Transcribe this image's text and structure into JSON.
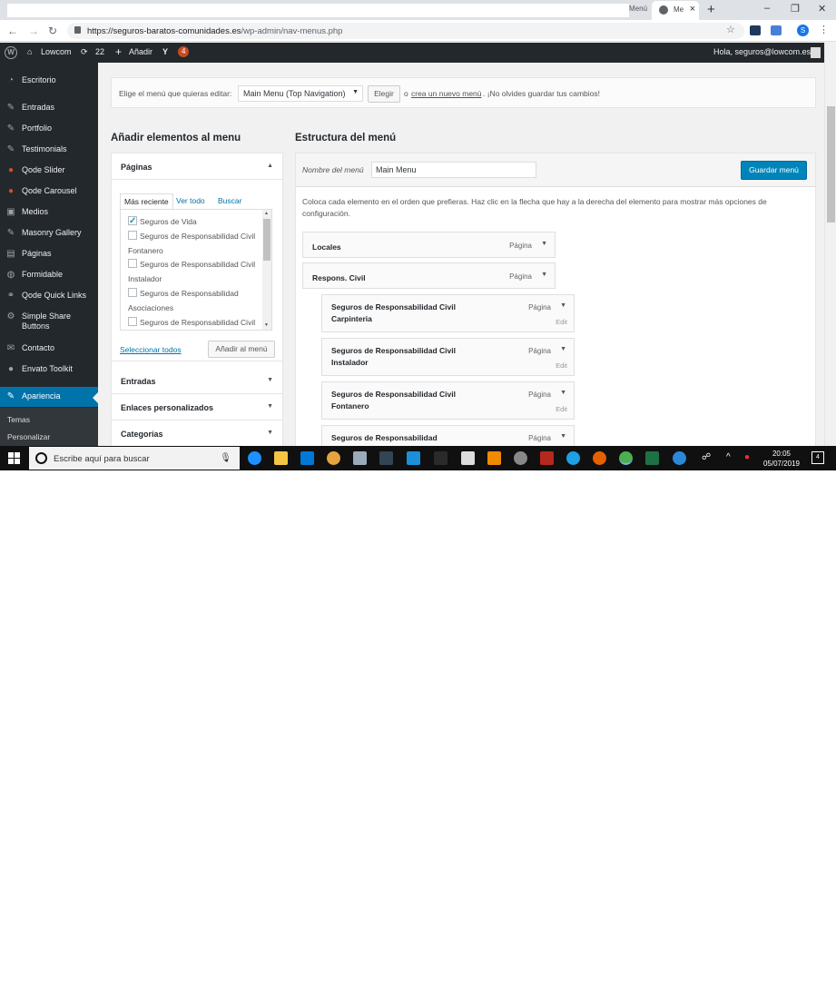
{
  "browser": {
    "tab_inactive": "Menú",
    "tab_active": "Me",
    "url_host": "https://seguros-baratos-comunidades.es",
    "url_path": "/wp-admin/nav-menus.php",
    "profile_initial": "S"
  },
  "adminbar": {
    "site": "Lowcom",
    "updates": "22",
    "new": "Añadir",
    "notifications": "4",
    "greeting": "Hola, seguros@lowcom.es"
  },
  "sidebar": {
    "items": [
      {
        "label": "Escritorio",
        "icon": "dashboard-icon"
      },
      {
        "label": "Entradas",
        "icon": "pin-icon"
      },
      {
        "label": "Portfolio",
        "icon": "pin-icon"
      },
      {
        "label": "Testimonials",
        "icon": "pin-icon"
      },
      {
        "label": "Qode Slider",
        "icon": "qode-icon"
      },
      {
        "label": "Qode Carousel",
        "icon": "qode-icon"
      },
      {
        "label": "Medios",
        "icon": "media-icon"
      },
      {
        "label": "Masonry Gallery",
        "icon": "pin-icon"
      },
      {
        "label": "Páginas",
        "icon": "page-icon"
      },
      {
        "label": "Formidable",
        "icon": "formidable-icon"
      },
      {
        "label": "Qode Quick Links",
        "icon": "link-icon"
      },
      {
        "label": "Simple Share Buttons",
        "icon": "share-icon"
      },
      {
        "label": "Contacto",
        "icon": "mail-icon"
      },
      {
        "label": "Envato Toolkit",
        "icon": "envato-icon"
      },
      {
        "label": "Apariencia",
        "icon": "brush-icon"
      }
    ],
    "sub": [
      "Temas",
      "Personalizar"
    ]
  },
  "manage": {
    "prompt": "Elige el menú que quieras editar:",
    "selected": "Main Menu (Top Navigation)",
    "select_btn": "Elegir",
    "or": "o",
    "create_link": "crea un nuevo menú",
    "reminder": ". ¡No olvides guardar tus cambios!"
  },
  "add_items": {
    "title": "Añadir elementos al menu",
    "pages_section": "Páginas",
    "tabs": [
      "Más reciente",
      "Ver todo",
      "Buscar"
    ],
    "pages": [
      {
        "label": "Seguros de Vida",
        "checked": true
      },
      {
        "label": "Seguros de Responsabilidad Civil Fontanero",
        "checked": false
      },
      {
        "label": "Seguros de Responsabilidad Civil Instalador",
        "checked": false
      },
      {
        "label": "Seguros de Responsabilidad Asociaciones",
        "checked": false
      },
      {
        "label": "Seguros de Responsabilidad Civil",
        "checked": false
      }
    ],
    "select_all": "Seleccionar todos",
    "add_btn": "Añadir al menú",
    "sections": [
      "Entradas",
      "Enlaces personalizados",
      "Categorías"
    ]
  },
  "structure": {
    "title": "Estructura del menú",
    "name_label": "Nombre del menú",
    "name_value": "Main Menu",
    "save_btn": "Guardar menú",
    "instructions": "Coloca cada elemento en el orden que prefieras. Haz clic en la flecha que hay a la derecha del elemento para mostrar más opciones de configuración.",
    "type_label": "Página",
    "edit_label": "Edit",
    "items": [
      {
        "title": "Locales"
      },
      {
        "title": "Respons. Civil"
      },
      {
        "title": "Seguros de Responsabilidad Civil Carpinteria"
      },
      {
        "title": "Seguros de Responsabilidad Civil Instalador"
      },
      {
        "title": "Seguros de Responsabilidad Civil Fontanero"
      },
      {
        "title": "Seguros de Responsabilidad"
      }
    ]
  },
  "taskbar": {
    "search_placeholder": "Escribe aquí para buscar",
    "time": "20:05",
    "date": "05/07/2019",
    "notif_count": "4"
  }
}
